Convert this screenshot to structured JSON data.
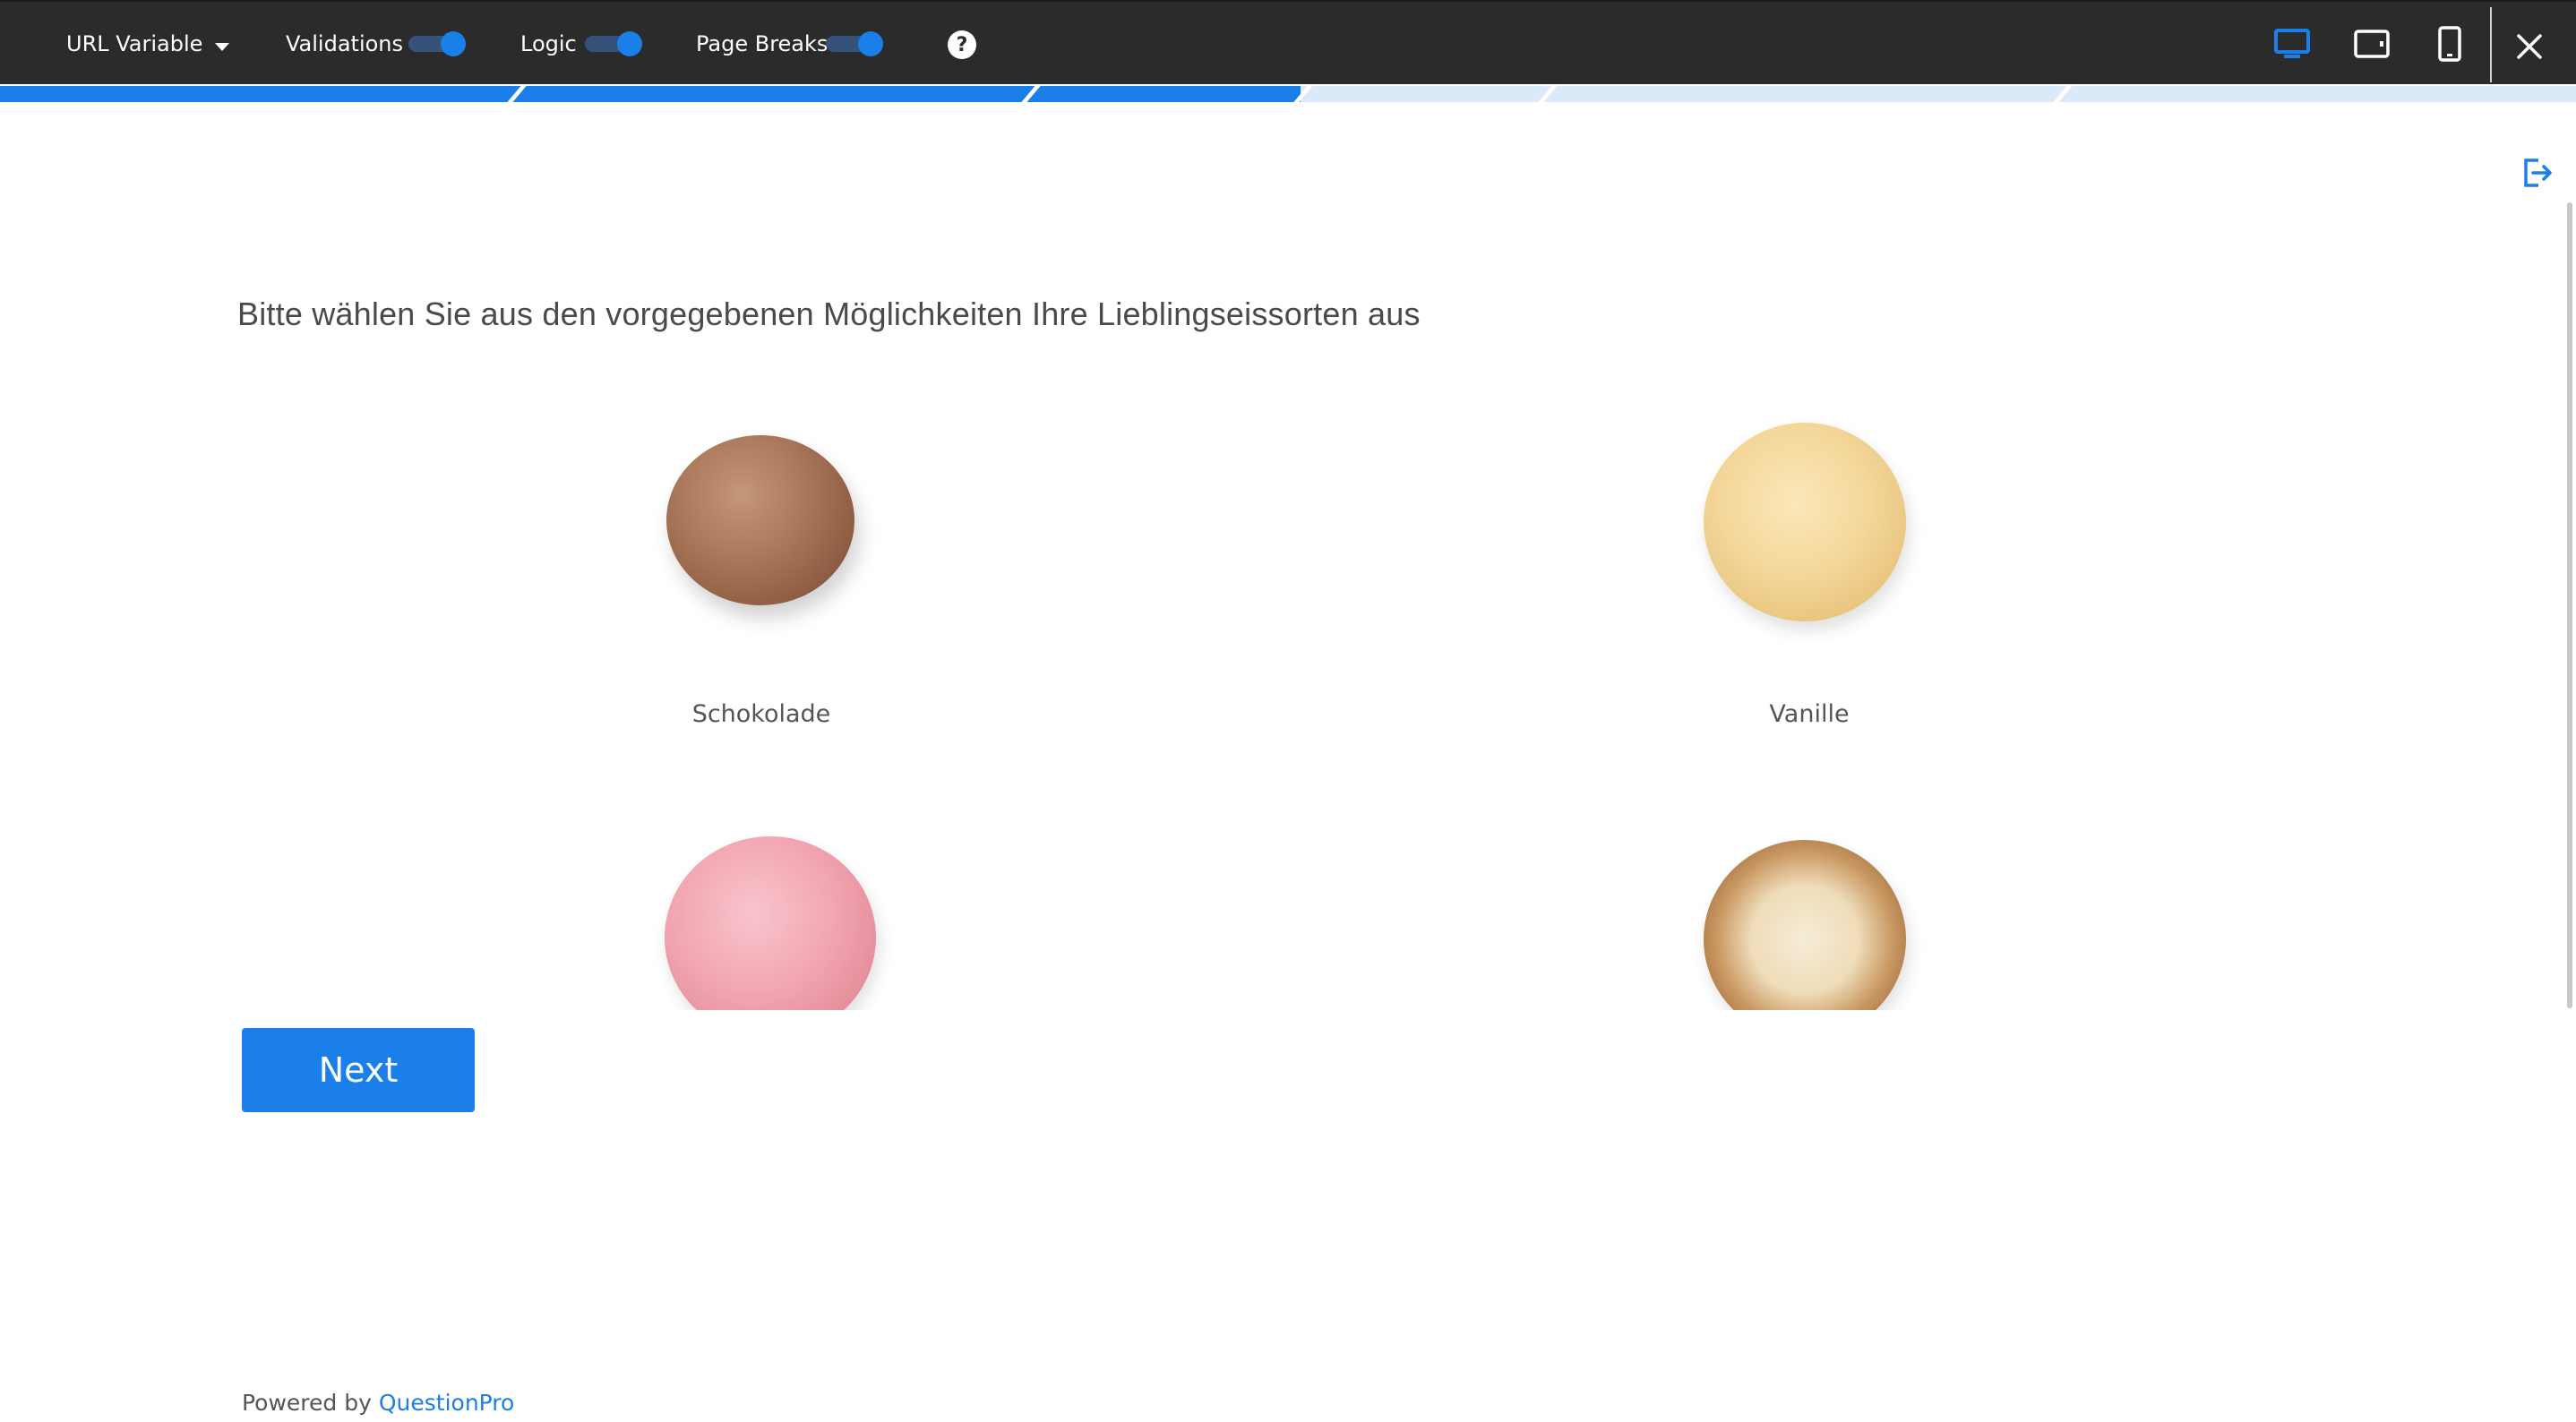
{
  "toolbar": {
    "url_variable_label": "URL Variable",
    "validations_label": "Validations",
    "validations_on": true,
    "logic_label": "Logic",
    "logic_on": true,
    "page_breaks_label": "Page Breaks",
    "page_breaks_on": true,
    "help_glyph": "?",
    "devices": [
      "desktop-icon",
      "tablet-icon",
      "mobile-icon"
    ],
    "active_device": "desktop",
    "close_glyph": "✕"
  },
  "progress": {
    "filled_fraction": 0.505,
    "segments": 6
  },
  "survey": {
    "question": "Bitte wählen Sie aus den vorgegebenen Möglichkeiten Ihre Lieblingseissorten aus",
    "choices": [
      {
        "label": "Schokolade",
        "icon": "chocolate-ice-cream-image"
      },
      {
        "label": "Vanille",
        "icon": "vanilla-ice-cream-image"
      },
      {
        "label": "",
        "icon": "strawberry-ice-cream-image"
      },
      {
        "label": "",
        "icon": "cookie-ice-cream-image"
      }
    ],
    "next_label": "Next"
  },
  "footer": {
    "powered_prefix": "Powered by ",
    "brand": "QuestionPro"
  },
  "colors": {
    "accent": "#1a7fe8",
    "toolbar_bg": "#2b2b2b",
    "progress_track": "#dbe9f8"
  }
}
